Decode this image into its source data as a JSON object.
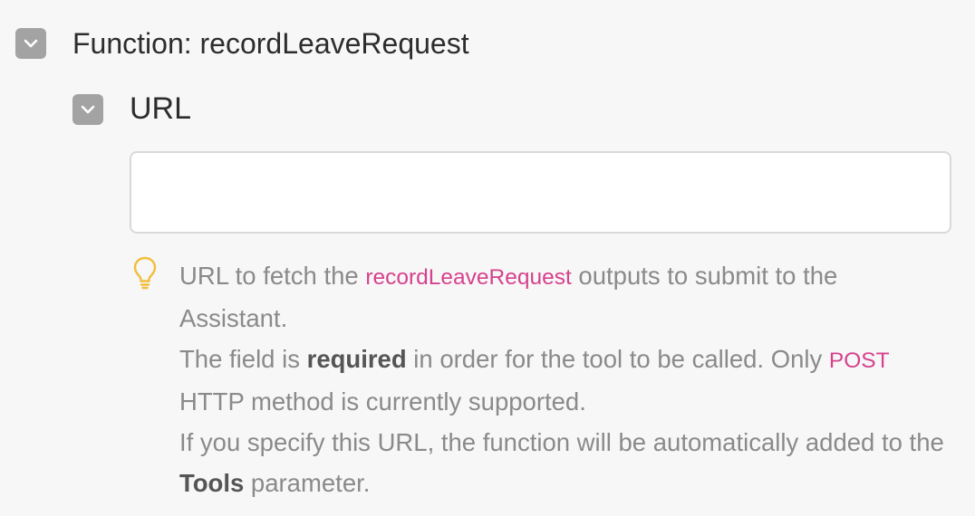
{
  "function_section": {
    "title": "Function: recordLeaveRequest",
    "toggle_icon": "chevron-down-icon"
  },
  "url_section": {
    "title": "URL",
    "toggle_icon": "chevron-down-icon",
    "input_value": "",
    "input_placeholder": ""
  },
  "hint": {
    "icon": "lightbulb-icon",
    "line1_pre": "URL to fetch the ",
    "line1_code": "recordLeaveRequest",
    "line1_post": " outputs to submit to the Assistant.",
    "line2_pre": "The field is ",
    "line2_strong": "required",
    "line2_mid": " in order for the tool to be called. Only ",
    "line2_code": "POST",
    "line2_post": " HTTP method is currently supported.",
    "line3_pre": "If you specify this URL, the function will be automatically added to the ",
    "line3_strong": "Tools",
    "line3_post": " parameter."
  },
  "colors": {
    "background": "#f7f7f7",
    "toggle": "#a3a3a3",
    "code_accent": "#d6428e",
    "hint_icon": "#f2bd3a"
  }
}
